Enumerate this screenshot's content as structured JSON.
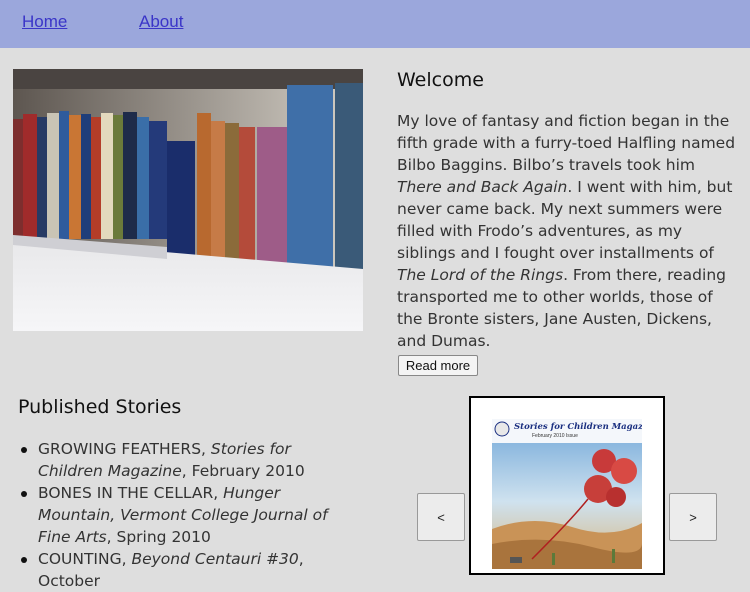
{
  "nav": {
    "home": "Home",
    "about": "About"
  },
  "welcome": {
    "title": "Welcome",
    "p1": "My love of fantasy and fiction began in the fifth grade with a furry-toed Halfling named Bilbo Baggins. Bilbo’s travels took him ",
    "italic1": "There and Back Again",
    "p2": ". I went with him, but never came back. My next summers were filled with Frodo’s adventures, as my siblings and I fought over installments of ",
    "italic2": "The Lord of the Rings",
    "p3": ". From there, reading transported me to other worlds, those of the Bronte sisters, Jane Austen, Dickens, and Dumas.",
    "read_more": "Read more"
  },
  "stories": {
    "title": "Published Stories",
    "items": [
      {
        "title": "GROWING FEATHERS, ",
        "venue": "Stories for Children Magazine",
        "date": ", February 2010"
      },
      {
        "title": "BONES IN THE CELLAR, ",
        "venue": "Hunger Mountain, Vermont College Journal of Fine Arts",
        "date": ", Spring 2010"
      },
      {
        "title": "COUNTING, ",
        "venue": "Beyond Centauri #30",
        "date": ", October"
      }
    ]
  },
  "carousel": {
    "prev": "<",
    "next": ">",
    "cover_title": "Stories for Children Magazine",
    "cover_subtitle": "February 2010 Issue"
  },
  "colors": {
    "nav_bg": "#9ba7dc",
    "link": "#3a35c8",
    "page_bg": "#dedede"
  }
}
